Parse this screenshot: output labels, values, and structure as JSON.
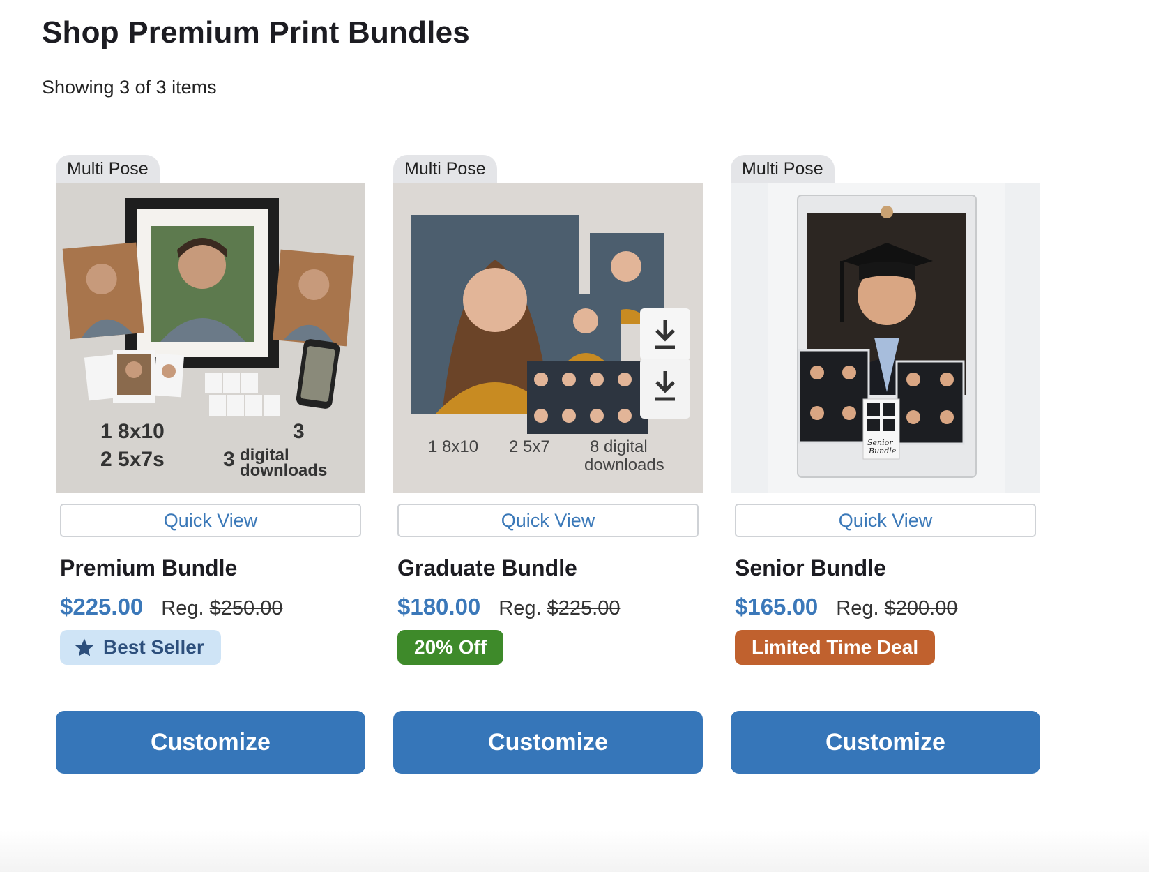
{
  "page": {
    "title": "Shop Premium Print Bundles",
    "result_count": "Showing 3 of 3 items"
  },
  "products": [
    {
      "tag": "Multi Pose",
      "quick_view": "Quick View",
      "name": "Premium Bundle",
      "price": "$225.00",
      "reg_label": "Reg.",
      "reg_price": "$250.00",
      "badge": "Best Seller",
      "badge_icon": "star-icon",
      "cta": "Customize",
      "image_text": {
        "line1": "1 8x10",
        "line2": "2 5x7s",
        "count": "3",
        "count2": "3",
        "dl1": "digital",
        "dl2": "downloads"
      }
    },
    {
      "tag": "Multi Pose",
      "quick_view": "Quick View",
      "name": "Graduate Bundle",
      "price": "$180.00",
      "reg_label": "Reg.",
      "reg_price": "$225.00",
      "badge": "20% Off",
      "cta": "Customize",
      "image_text": {
        "a": "1 8x10",
        "b": "2 5x7",
        "c1": "8 digital",
        "c2": "downloads"
      }
    },
    {
      "tag": "Multi Pose",
      "quick_view": "Quick View",
      "name": "Senior Bundle",
      "price": "$165.00",
      "reg_label": "Reg.",
      "reg_price": "$200.00",
      "badge": "Limited Time Deal",
      "cta": "Customize",
      "image_text": {
        "l1": "Senior",
        "l2": "Bundle"
      }
    }
  ],
  "colors": {
    "accent": "#3676b9",
    "price": "#3b78b9",
    "best_seller_bg": "#cfe4f6",
    "off_bg": "#3e8a2a",
    "deal_bg": "#c0612e"
  }
}
